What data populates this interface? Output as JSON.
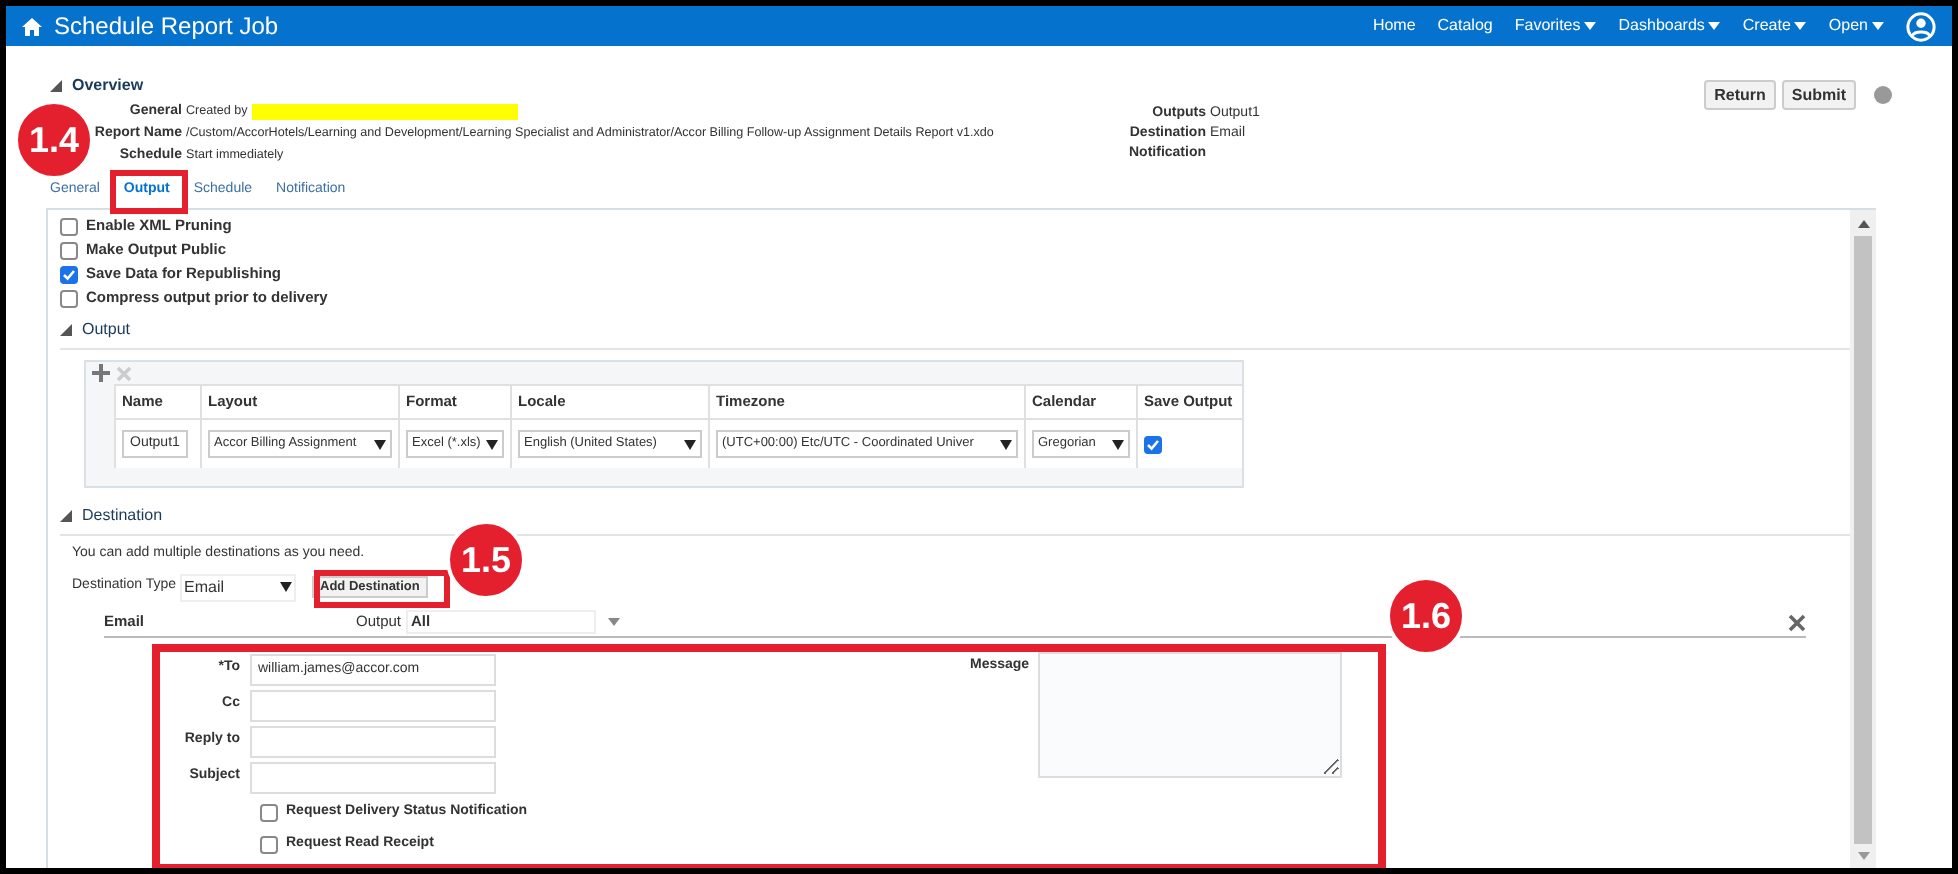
{
  "header": {
    "title": "Schedule Report Job",
    "nav": [
      {
        "label": "Home",
        "dropdown": false
      },
      {
        "label": "Catalog",
        "dropdown": false
      },
      {
        "label": "Favorites",
        "dropdown": true
      },
      {
        "label": "Dashboards",
        "dropdown": true
      },
      {
        "label": "Create",
        "dropdown": true
      },
      {
        "label": "Open",
        "dropdown": true
      }
    ]
  },
  "overview": {
    "title": "Overview",
    "left": [
      {
        "label": "General",
        "value": "Created by",
        "redacted": true
      },
      {
        "label": "Report Name",
        "value": "/Custom/AccorHotels/Learning and Development/Learning Specialist and Administrator/Accor Billing Follow-up Assignment Details Report v1.xdo",
        "redacted": false
      },
      {
        "label": "Schedule",
        "value": "Start immediately",
        "redacted": false
      }
    ],
    "right": [
      {
        "label": "Outputs",
        "value": "Output1"
      },
      {
        "label": "Destination",
        "value": "Email"
      },
      {
        "label": "Notification"
      }
    ]
  },
  "buttons": [
    "Return",
    "Submit"
  ],
  "tabs": [
    {
      "label": "General",
      "selected": false
    },
    {
      "label": "Output",
      "selected": true
    },
    {
      "label": "Schedule",
      "selected": false
    },
    {
      "label": "Notification",
      "selected": false
    }
  ],
  "options": [
    {
      "label": "Enable XML Pruning",
      "checked": false
    },
    {
      "label": "Make Output Public",
      "checked": false
    },
    {
      "label": "Save Data for Republishing",
      "checked": true
    },
    {
      "label": "Compress output prior to delivery",
      "checked": false
    }
  ],
  "output": {
    "title": "Output",
    "columns": [
      "Name",
      "Layout",
      "Format",
      "Locale",
      "Timezone",
      "Calendar",
      "Save Output"
    ],
    "rows": [
      {
        "cells": [
          {
            "kind": "input",
            "value": "Output1"
          },
          {
            "kind": "select",
            "value": "Accor Billing Assignment"
          },
          {
            "kind": "select",
            "value": "Excel (*.xls)"
          },
          {
            "kind": "select",
            "value": "English (United States)"
          },
          {
            "kind": "select",
            "value": "(UTC+00:00) Etc/UTC - Coordinated Univer"
          },
          {
            "kind": "select",
            "value": "Gregorian"
          },
          {
            "kind": "checkbox",
            "checked": true
          }
        ]
      }
    ]
  },
  "destination": {
    "title": "Destination",
    "hint": "You can add multiple destinations as you need.",
    "type_label": "Destination Type",
    "type_value": "Email",
    "add_button": "Add Destination",
    "email": {
      "title": "Email",
      "output_label": "Output",
      "output_value": "All",
      "fields": [
        {
          "label": "*To",
          "value": "william.james@accor.com"
        },
        {
          "label": "Cc"
        },
        {
          "label": "Reply to"
        },
        {
          "label": "Subject"
        }
      ],
      "message_label": "Message",
      "options": [
        {
          "label": "Request Delivery Status Notification",
          "checked": false
        },
        {
          "label": "Request Read Receipt",
          "checked": false
        }
      ]
    }
  },
  "annotations": [
    {
      "label": "1.4"
    },
    {
      "label": "1.5"
    },
    {
      "label": "1.6"
    }
  ]
}
